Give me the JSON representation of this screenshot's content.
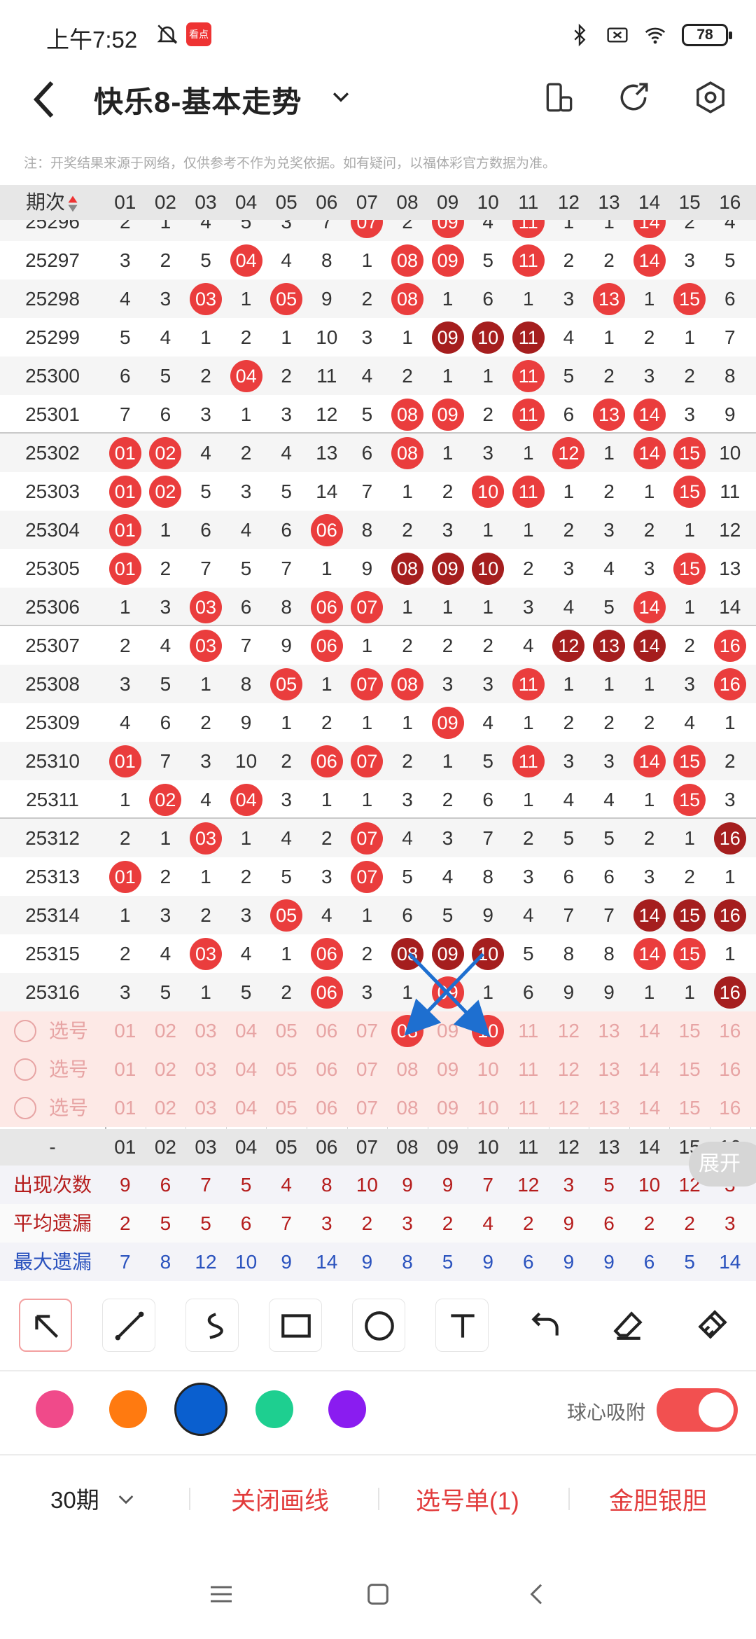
{
  "status": {
    "time": "上午7:52",
    "app_badge": "看点",
    "battery": "78"
  },
  "header": {
    "title": "快乐8-基本走势"
  },
  "notice": "注：开奖结果来源于网络，仅供参考不作为兑奖依据。如有疑问，以福体彩官方数据为准。",
  "table": {
    "col_label": "期次",
    "columns": [
      "01",
      "02",
      "03",
      "04",
      "05",
      "06",
      "07",
      "08",
      "09",
      "10",
      "11",
      "12",
      "13",
      "14",
      "15",
      "16"
    ],
    "partial_first_issue": "25296",
    "rows": [
      {
        "issue": "25296",
        "cells": [
          "2",
          "1",
          "4",
          "5",
          "3",
          "7",
          "r:07",
          "2",
          "r:09",
          "4",
          "r:11",
          "1",
          "1",
          "r:14",
          "2",
          "4"
        ]
      },
      {
        "issue": "25297",
        "cells": [
          "3",
          "2",
          "5",
          "r:04",
          "4",
          "8",
          "1",
          "r:08",
          "r:09",
          "5",
          "r:11",
          "2",
          "2",
          "r:14",
          "3",
          "5"
        ]
      },
      {
        "issue": "25298",
        "cells": [
          "4",
          "3",
          "r:03",
          "1",
          "r:05",
          "9",
          "2",
          "r:08",
          "1",
          "6",
          "1",
          "3",
          "r:13",
          "1",
          "r:15",
          "6"
        ]
      },
      {
        "issue": "25299",
        "cells": [
          "5",
          "4",
          "1",
          "2",
          "1",
          "10",
          "3",
          "1",
          "d:09",
          "d:10",
          "d:11",
          "4",
          "1",
          "2",
          "1",
          "7"
        ]
      },
      {
        "issue": "25300",
        "cells": [
          "6",
          "5",
          "2",
          "r:04",
          "2",
          "11",
          "4",
          "2",
          "1",
          "1",
          "r:11",
          "5",
          "2",
          "3",
          "2",
          "8"
        ]
      },
      {
        "issue": "25301",
        "cells": [
          "7",
          "6",
          "3",
          "1",
          "3",
          "12",
          "5",
          "r:08",
          "r:09",
          "2",
          "r:11",
          "6",
          "r:13",
          "r:14",
          "3",
          "9"
        ]
      },
      {
        "issue": "25302",
        "cells": [
          "r:01",
          "r:02",
          "4",
          "2",
          "4",
          "13",
          "6",
          "r:08",
          "1",
          "3",
          "1",
          "r:12",
          "1",
          "r:14",
          "r:15",
          "10"
        ]
      },
      {
        "issue": "25303",
        "cells": [
          "r:01",
          "r:02",
          "5",
          "3",
          "5",
          "14",
          "7",
          "1",
          "2",
          "r:10",
          "r:11",
          "1",
          "2",
          "1",
          "r:15",
          "11"
        ]
      },
      {
        "issue": "25304",
        "cells": [
          "r:01",
          "1",
          "6",
          "4",
          "6",
          "r:06",
          "8",
          "2",
          "3",
          "1",
          "1",
          "2",
          "3",
          "2",
          "1",
          "12"
        ]
      },
      {
        "issue": "25305",
        "cells": [
          "r:01",
          "2",
          "7",
          "5",
          "7",
          "1",
          "9",
          "d:08",
          "d:09",
          "d:10",
          "2",
          "3",
          "4",
          "3",
          "r:15",
          "13"
        ]
      },
      {
        "issue": "25306",
        "cells": [
          "1",
          "3",
          "r:03",
          "6",
          "8",
          "r:06",
          "r:07",
          "1",
          "1",
          "1",
          "3",
          "4",
          "5",
          "r:14",
          "1",
          "14"
        ]
      },
      {
        "issue": "25307",
        "cells": [
          "2",
          "4",
          "r:03",
          "7",
          "9",
          "r:06",
          "1",
          "2",
          "2",
          "2",
          "4",
          "d:12",
          "d:13",
          "d:14",
          "2",
          "r:16"
        ]
      },
      {
        "issue": "25308",
        "cells": [
          "3",
          "5",
          "1",
          "8",
          "r:05",
          "1",
          "r:07",
          "r:08",
          "3",
          "3",
          "r:11",
          "1",
          "1",
          "1",
          "3",
          "r:16"
        ]
      },
      {
        "issue": "25309",
        "cells": [
          "4",
          "6",
          "2",
          "9",
          "1",
          "2",
          "1",
          "1",
          "r:09",
          "4",
          "1",
          "2",
          "2",
          "2",
          "4",
          "1"
        ]
      },
      {
        "issue": "25310",
        "cells": [
          "r:01",
          "7",
          "3",
          "10",
          "2",
          "r:06",
          "r:07",
          "2",
          "1",
          "5",
          "r:11",
          "3",
          "3",
          "r:14",
          "r:15",
          "2"
        ]
      },
      {
        "issue": "25311",
        "cells": [
          "1",
          "r:02",
          "4",
          "r:04",
          "3",
          "1",
          "1",
          "3",
          "2",
          "6",
          "1",
          "4",
          "4",
          "1",
          "r:15",
          "3"
        ]
      },
      {
        "issue": "25312",
        "cells": [
          "2",
          "1",
          "r:03",
          "1",
          "4",
          "2",
          "r:07",
          "4",
          "3",
          "7",
          "2",
          "5",
          "5",
          "2",
          "1",
          "d:16"
        ]
      },
      {
        "issue": "25313",
        "cells": [
          "r:01",
          "2",
          "1",
          "2",
          "5",
          "3",
          "r:07",
          "5",
          "4",
          "8",
          "3",
          "6",
          "6",
          "3",
          "2",
          "1"
        ]
      },
      {
        "issue": "25314",
        "cells": [
          "1",
          "3",
          "2",
          "3",
          "r:05",
          "4",
          "1",
          "6",
          "5",
          "9",
          "4",
          "7",
          "7",
          "d:14",
          "d:15",
          "d:16"
        ]
      },
      {
        "issue": "25315",
        "cells": [
          "2",
          "4",
          "r:03",
          "4",
          "1",
          "r:06",
          "2",
          "d:08",
          "d:09",
          "d:10",
          "5",
          "8",
          "8",
          "r:14",
          "r:15",
          "1"
        ]
      },
      {
        "issue": "25316",
        "cells": [
          "3",
          "5",
          "1",
          "5",
          "2",
          "r:06",
          "3",
          "1",
          "r:09",
          "1",
          "6",
          "9",
          "9",
          "1",
          "1",
          "d:16"
        ]
      }
    ],
    "select_label": "选号",
    "select_rows": 3
  },
  "footer": {
    "dash": "-",
    "counts_label": "出现次数",
    "counts": [
      "9",
      "6",
      "7",
      "5",
      "4",
      "8",
      "10",
      "9",
      "9",
      "7",
      "12",
      "3",
      "5",
      "10",
      "12",
      "3"
    ],
    "avg_label": "平均遗漏",
    "avg": [
      "2",
      "5",
      "5",
      "6",
      "7",
      "3",
      "2",
      "3",
      "2",
      "4",
      "2",
      "9",
      "6",
      "2",
      "2",
      "3"
    ],
    "max_label": "最大遗漏",
    "max": [
      "7",
      "8",
      "12",
      "10",
      "9",
      "14",
      "9",
      "8",
      "5",
      "9",
      "6",
      "9",
      "9",
      "6",
      "5",
      "14"
    ],
    "expand": "展开"
  },
  "palette": [
    "#f04a8a",
    "#ff7a10",
    "#0a5fcf",
    "#1ecf90",
    "#8a1cf0"
  ],
  "palette_selected": 2,
  "magnet_label": "球心吸附",
  "magnet_on": true,
  "bottom": {
    "period": "30期",
    "close_lines": "关闭画线",
    "pick_list": "选号单(1)",
    "golden": "金胆银胆"
  },
  "drawing_color": "#1e6fd0"
}
